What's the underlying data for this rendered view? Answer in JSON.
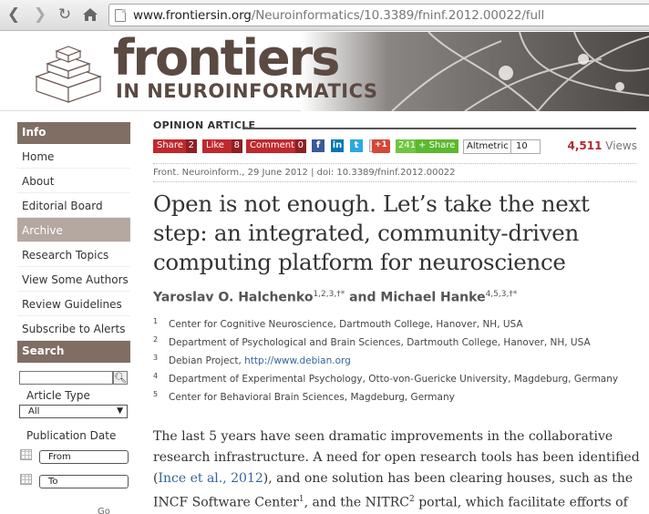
{
  "browser": {
    "url_host": "www.frontiersin.org",
    "url_path": "/Neuroinformatics/10.3389/fninf.2012.00022/full"
  },
  "header": {
    "brand": "frontiers",
    "subtitle": "IN NEUROINFORMATICS"
  },
  "sidebar": {
    "info_heading": "Info",
    "items": [
      {
        "label": "Home"
      },
      {
        "label": "About"
      },
      {
        "label": "Editorial Board"
      },
      {
        "label": "Archive"
      },
      {
        "label": "Research Topics"
      },
      {
        "label": "View Some Authors"
      },
      {
        "label": "Review Guidelines"
      },
      {
        "label": "Subscribe to Alerts"
      }
    ],
    "search_heading": "Search",
    "article_type_label": "Article Type",
    "article_type_value": "All",
    "publication_date_label": "Publication Date",
    "from_label": "From",
    "to_label": "To",
    "go_label": "Go"
  },
  "article": {
    "type": "OPINION ARTICLE",
    "share": {
      "label": "Share",
      "count": "2"
    },
    "like": {
      "label": "Like",
      "count": "8"
    },
    "comment": {
      "label": "Comment",
      "count": "0"
    },
    "gplus": "+1",
    "share_count": "241",
    "share2": "Share",
    "altmetric_label": "Altmetric",
    "altmetric_count": "10",
    "views_count": "4,511",
    "views_label": "Views",
    "citation": "Front. Neuroinform., 29 June 2012 | doi: 10.3389/fninf.2012.00022",
    "title": "Open is not enough. Let’s take the next step: an integrated, community-driven computing platform for neuroscience",
    "author1": "Yaroslav O. Halchenko",
    "author1_sup": "1,2,3,†*",
    "and": "and",
    "author2": "Michael Hanke",
    "author2_sup": "4,5,3,†*",
    "affiliations": [
      {
        "n": "1",
        "text": "Center for Cognitive Neuroscience, Dartmouth College, Hanover, NH, USA"
      },
      {
        "n": "2",
        "text": "Department of Psychological and Brain Sciences, Dartmouth College, Hanover, NH, USA"
      },
      {
        "n": "3",
        "text": "Debian Project, ",
        "link": "http://www.debian.org"
      },
      {
        "n": "4",
        "text": "Department of Experimental Psychology, Otto-von-Guericke University, Magdeburg, Germany"
      },
      {
        "n": "5",
        "text": "Center for Behavioral Brain Sciences, Magdeburg, Germany"
      }
    ],
    "body_1": "The last 5 years have seen dramatic improvements in the collaborative research infrastructure. A need for open research tools has been identified (",
    "body_link": "Ince et al., 2012",
    "body_2": "), and one solution has been clearing houses, such as the INCF Software Center",
    "body_sup1": "1",
    "body_3": ", and the NITRC",
    "body_sup2": "2",
    "body_4": " portal, which facilitate efforts of"
  },
  "colors": {
    "sidebar_heading": "#806e64",
    "sidebar_active": "#b5a8a1",
    "brand": "#5a4a42",
    "share_red": "#c0282d",
    "link": "#336699"
  }
}
